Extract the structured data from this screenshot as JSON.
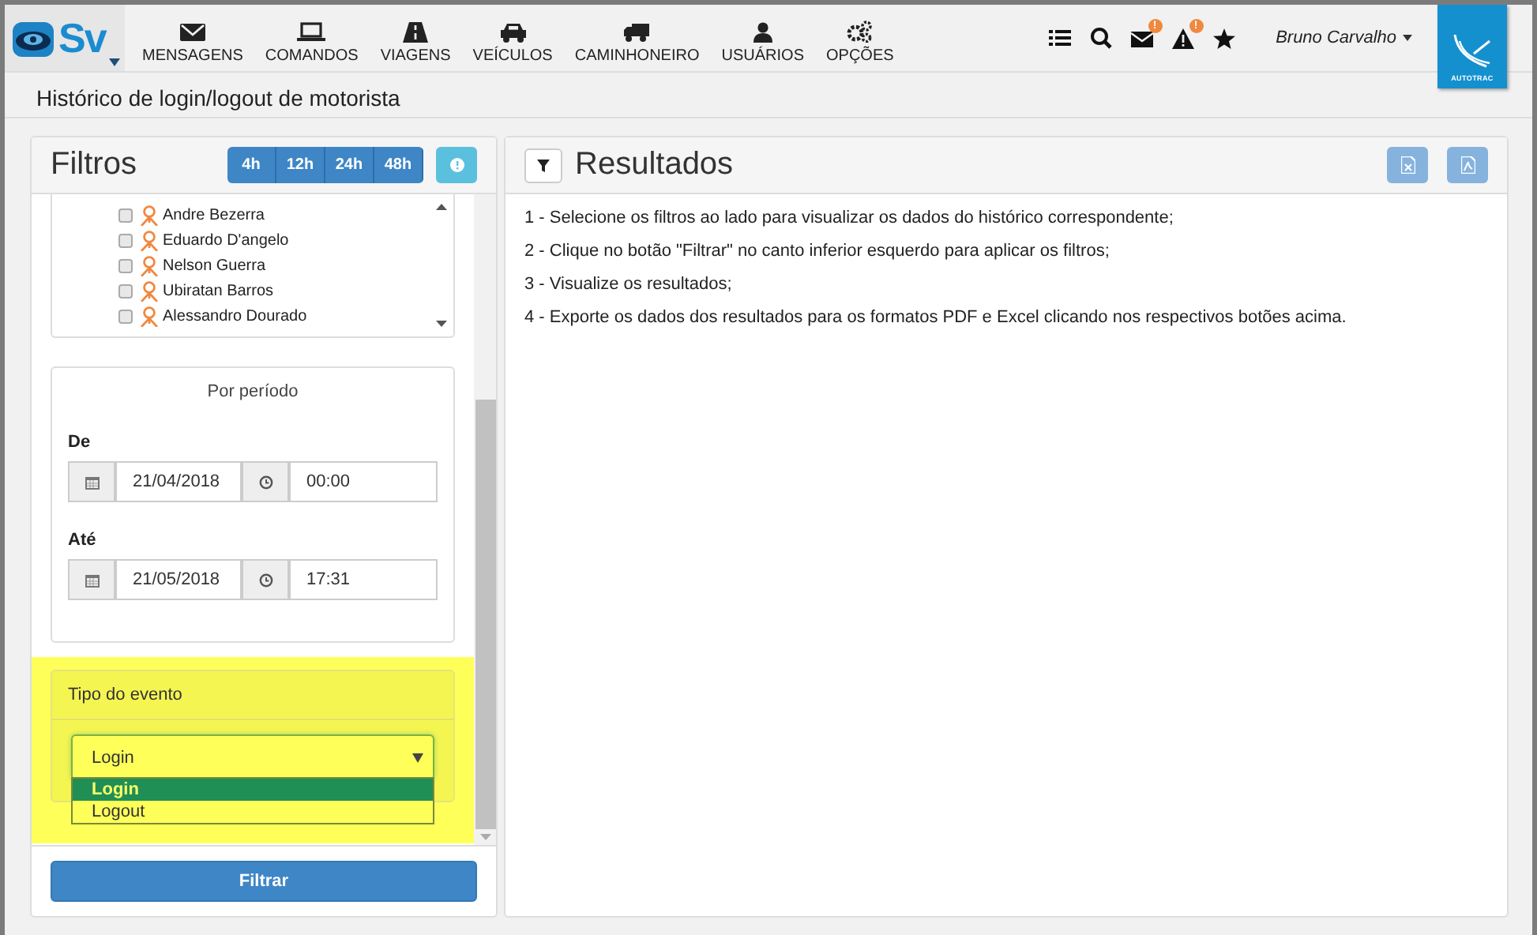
{
  "logo": {
    "text": "Sv"
  },
  "nav": [
    {
      "label": "MENSAGENS",
      "kind": "envelope"
    },
    {
      "label": "COMANDOS",
      "kind": "laptop"
    },
    {
      "label": "VIAGENS",
      "kind": "road"
    },
    {
      "label": "VEÍCULOS",
      "kind": "car"
    },
    {
      "label": "CAMINHONEIRO",
      "kind": "truck"
    },
    {
      "label": "USUÁRIOS",
      "kind": "user"
    },
    {
      "label": "OPÇÕES",
      "kind": "gears"
    }
  ],
  "toolbar": {
    "icons": [
      {
        "kind": "list"
      },
      {
        "kind": "search"
      },
      {
        "kind": "mail",
        "badge": "!"
      },
      {
        "kind": "alert",
        "badge": "!"
      },
      {
        "kind": "star"
      }
    ],
    "user": "Bruno Carvalho"
  },
  "brand": {
    "text": "AUTOTRAC"
  },
  "page_title": "Histórico de login/logout de motorista",
  "filters": {
    "title": "Filtros",
    "time_buttons": [
      "4h",
      "12h",
      "24h",
      "48h"
    ],
    "drivers": [
      {
        "name": "Andre Bezerra",
        "checked": false
      },
      {
        "name": "Eduardo D'angelo",
        "checked": false
      },
      {
        "name": "Nelson Guerra",
        "checked": false
      },
      {
        "name": "Ubiratan Barros",
        "checked": false
      },
      {
        "name": "Alessandro Dourado",
        "checked": false
      }
    ],
    "period": {
      "title": "Por período",
      "ranges": [
        {
          "label": "De",
          "date": "21/04/2018",
          "time": "00:00"
        },
        {
          "label": "Até",
          "date": "21/05/2018",
          "time": "17:31"
        }
      ]
    },
    "event_type": {
      "title": "Tipo do evento",
      "value": "Login",
      "options": [
        {
          "label": "Login",
          "selected": true
        },
        {
          "label": "Logout",
          "selected": false
        }
      ]
    },
    "submit": "Filtrar"
  },
  "results": {
    "title": "Resultados",
    "instructions": [
      "1 - Selecione os filtros ao lado para visualizar os dados do histórico correspondente;",
      "2 - Clique no botão \"Filtrar\" no canto inferior esquerdo para aplicar os filtros;",
      "3 - Visualize os resultados;",
      "4 - Exporte os dados dos resultados para os formatos PDF e Excel clicando nos respectivos botões acima."
    ]
  }
}
